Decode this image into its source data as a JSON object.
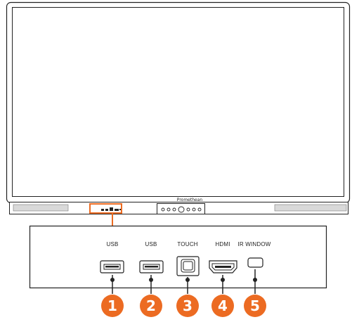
{
  "brand": "Promethean",
  "accent_color": "#ec6b22",
  "ports": [
    {
      "number": "1",
      "label": "USB",
      "icon": "usb-a-port-icon"
    },
    {
      "number": "2",
      "label": "USB",
      "icon": "usb-a-port-icon"
    },
    {
      "number": "3",
      "label": "TOUCH",
      "icon": "usb-b-port-icon"
    },
    {
      "number": "4",
      "label": "HDMI",
      "icon": "hdmi-port-icon"
    },
    {
      "number": "5",
      "label": "IR WINDOW",
      "icon": "ir-window-icon"
    }
  ]
}
